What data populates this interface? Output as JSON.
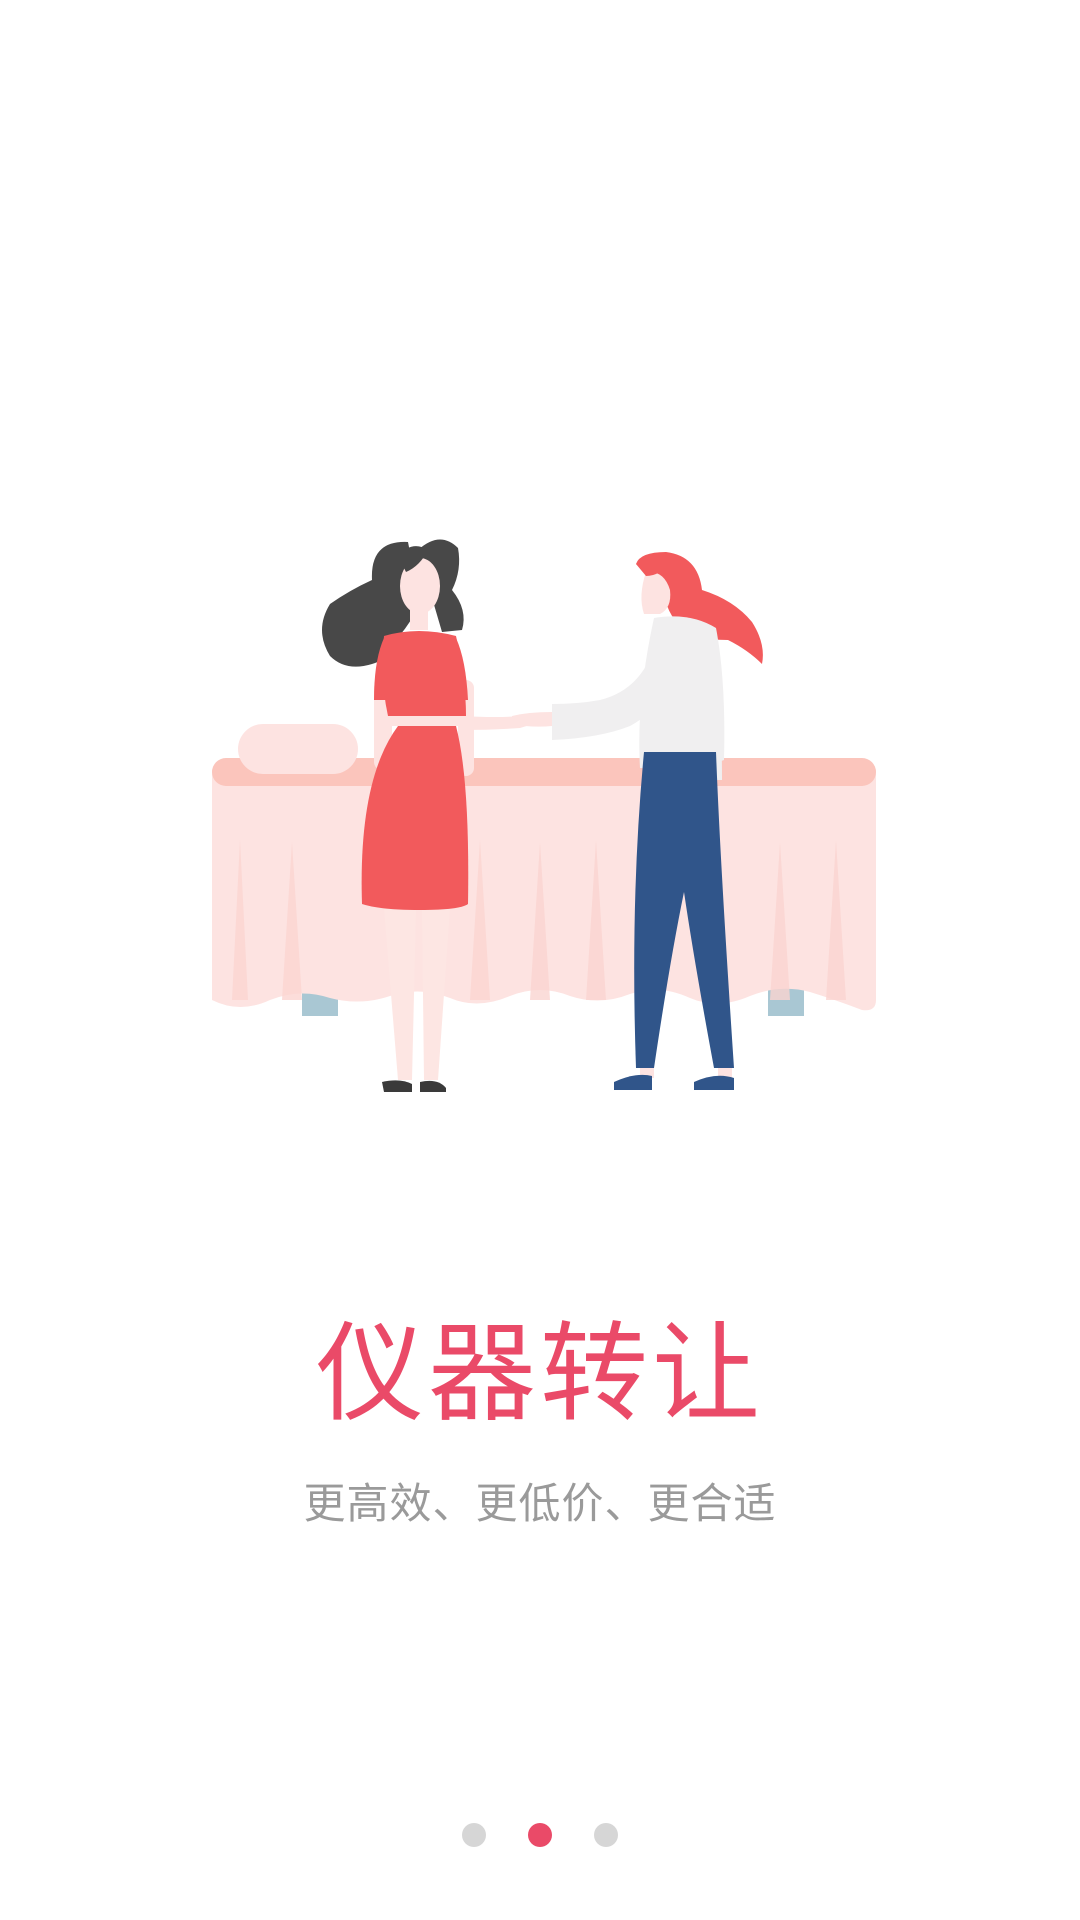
{
  "onboarding": {
    "title": "仪器转让",
    "subtitle": "更高效、更低价、更合适",
    "illustration_icon": "two-women-handshake-over-massage-bed-illustration",
    "pagination": {
      "pages": 3,
      "active_index": 1
    }
  },
  "colors": {
    "accent": "#ea4a68",
    "subtitle": "#9a9a9a",
    "dot_inactive": "#d6d6d6",
    "background": "#ffffff"
  }
}
